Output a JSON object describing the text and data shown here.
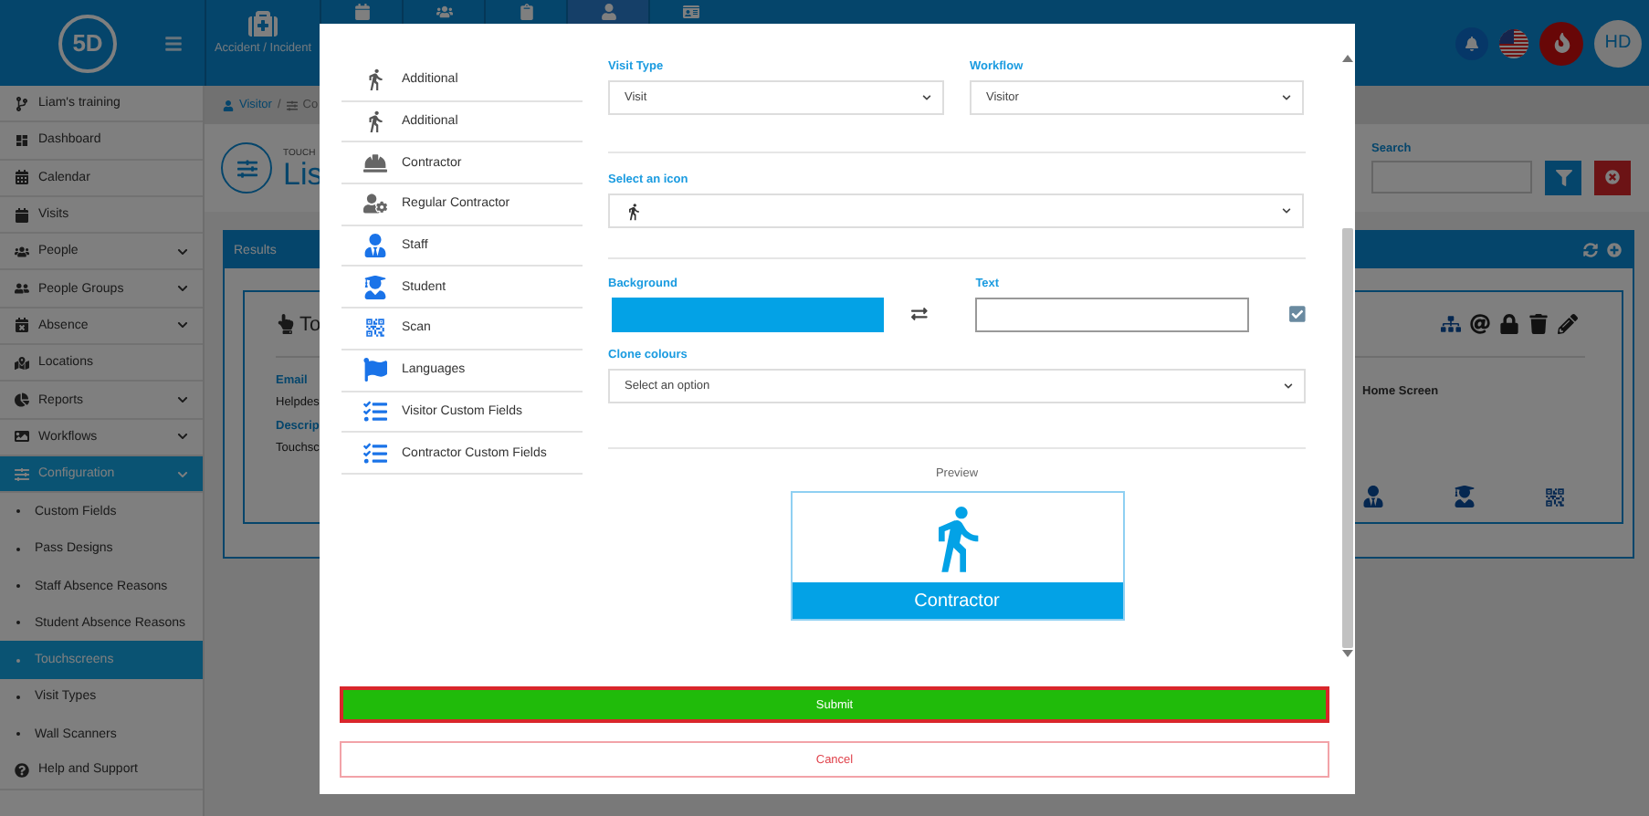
{
  "header": {
    "logo": "5D",
    "tiles": [
      {
        "label": "Accident / Incident",
        "selected": false
      },
      {
        "selected": false
      },
      {
        "selected": false
      },
      {
        "selected": false
      },
      {
        "selected": true
      },
      {
        "selected": false
      }
    ],
    "avatar": "HD"
  },
  "sidebar": {
    "items": [
      {
        "kind": "link",
        "label": "Liam's training",
        "selected": false
      },
      {
        "kind": "link",
        "label": "Dashboard",
        "selected": false
      },
      {
        "kind": "link",
        "label": "Calendar",
        "selected": false
      },
      {
        "kind": "link",
        "label": "Visits",
        "selected": false
      },
      {
        "kind": "group",
        "label": "People",
        "selected": false
      },
      {
        "kind": "group",
        "label": "People Groups",
        "selected": false
      },
      {
        "kind": "group",
        "label": "Absence",
        "selected": false
      },
      {
        "kind": "link",
        "label": "Locations",
        "selected": false
      },
      {
        "kind": "group",
        "label": "Reports",
        "selected": false
      },
      {
        "kind": "group",
        "label": "Workflows",
        "selected": false
      },
      {
        "kind": "group",
        "label": "Configuration",
        "selected": true,
        "children": [
          {
            "label": "Custom Fields",
            "selected": false
          },
          {
            "label": "Pass Designs",
            "selected": false
          },
          {
            "label": "Staff Absence Reasons",
            "selected": false
          },
          {
            "label": "Student Absence Reasons",
            "selected": false
          },
          {
            "label": "Touchscreens",
            "selected": true
          },
          {
            "label": "Visit Types",
            "selected": false
          },
          {
            "label": "Wall Scanners",
            "selected": false
          }
        ]
      },
      {
        "kind": "link",
        "label": "Help and Support",
        "selected": false
      }
    ]
  },
  "breadcrumb": [
    "Visitor",
    "/",
    "Co"
  ],
  "page": {
    "kicker": "TOUCH",
    "title": "Lis"
  },
  "search": {
    "label": "Search"
  },
  "results": {
    "title": "Results",
    "card": {
      "title": "To",
      "fields": [
        {
          "label": "Email",
          "value": "Helpdes"
        },
        {
          "label": "Descrip",
          "value": "Touchsc"
        }
      ],
      "home_screen": "Home Screen"
    }
  },
  "modal": {
    "types": [
      {
        "label": "Additional",
        "selected": false
      },
      {
        "label": "Additional",
        "selected": false
      },
      {
        "label": "Contractor",
        "selected": false
      },
      {
        "label": "Regular Contractor",
        "selected": false
      },
      {
        "label": "Staff",
        "selected": false
      },
      {
        "label": "Student",
        "selected": false
      },
      {
        "label": "Scan",
        "selected": false
      },
      {
        "label": "Languages",
        "selected": false
      },
      {
        "label": "Visitor Custom Fields",
        "selected": false
      },
      {
        "label": "Contractor Custom Fields",
        "selected": false
      }
    ],
    "visit_type": {
      "label": "Visit Type",
      "value": "Visit"
    },
    "workflow": {
      "label": "Workflow",
      "value": "Visitor"
    },
    "icon_select": {
      "label": "Select an icon"
    },
    "background": {
      "label": "Background"
    },
    "text": {
      "label": "Text",
      "checked": true
    },
    "clone": {
      "label": "Clone colours",
      "placeholder": "Select an option"
    },
    "preview": {
      "label": "Preview",
      "name": "Contractor"
    },
    "submit": "Submit",
    "cancel": "Cancel"
  }
}
